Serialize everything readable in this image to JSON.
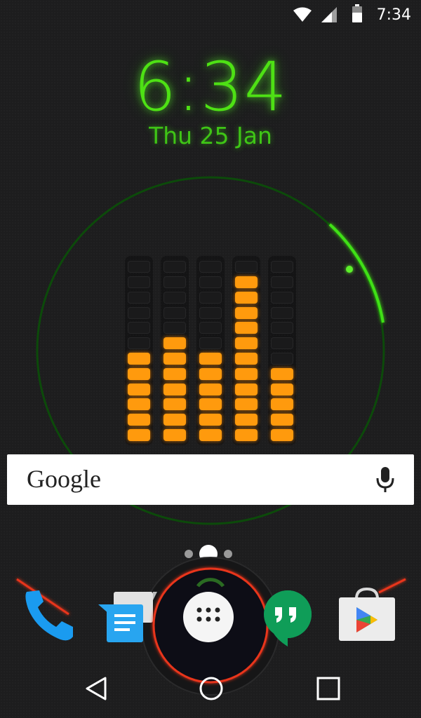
{
  "status_bar": {
    "time": "7:34",
    "icons": [
      "wifi-icon",
      "cell-signal-icon",
      "battery-icon"
    ]
  },
  "clock_widget": {
    "time": "6:34",
    "date": "Thu 25 Jan",
    "color": "#4ee114"
  },
  "equalizer": {
    "segments_per_column": 12,
    "lit_segments": [
      6,
      7,
      6,
      11,
      5
    ],
    "lit_color": "#ff9a0d"
  },
  "search_widget": {
    "logo": "Google",
    "mic_icon": "microphone-icon"
  },
  "pager": {
    "pages": 3,
    "active_index": 1
  },
  "dock": {
    "apps": [
      "phone-app",
      "messenger-app",
      "app-drawer",
      "hangouts-app",
      "play-store-app"
    ],
    "accent_color": "#e8341a"
  },
  "nav_bar": {
    "buttons": [
      "back-button",
      "home-button",
      "recents-button"
    ]
  }
}
